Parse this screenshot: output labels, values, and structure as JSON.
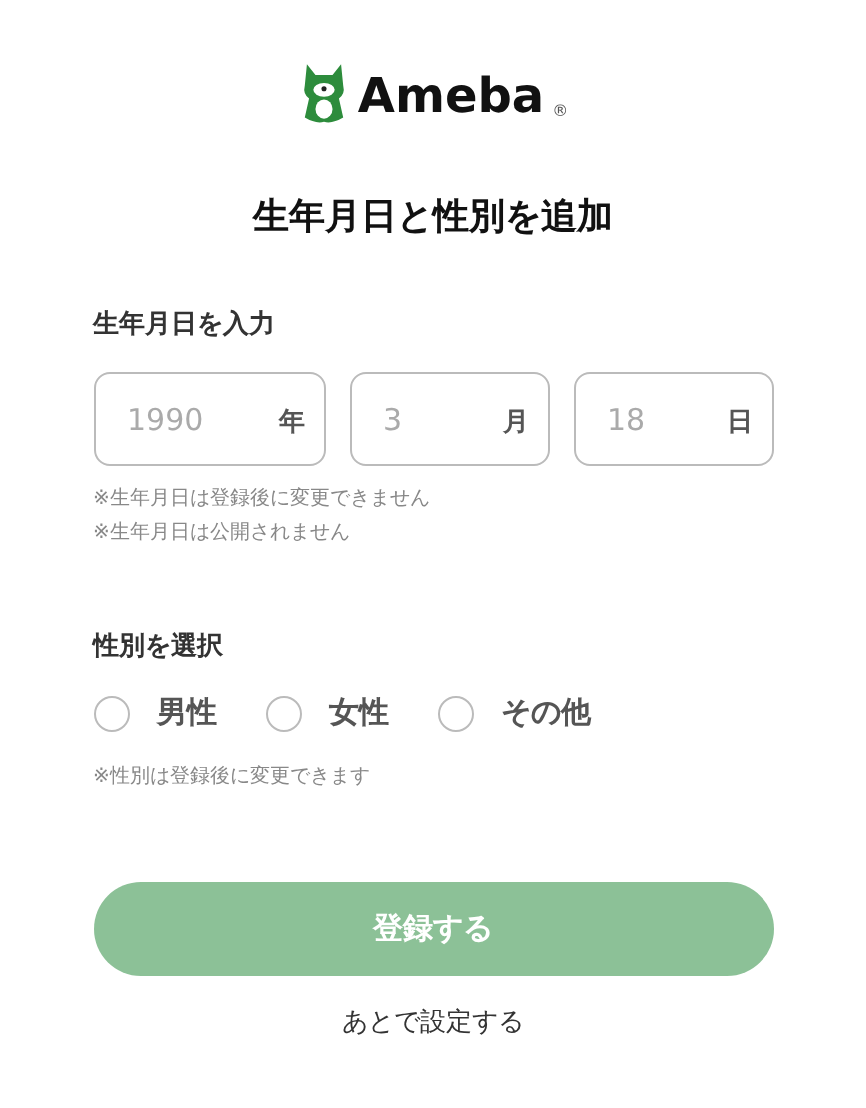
{
  "logo": {
    "text": "Ameba",
    "mark": "®"
  },
  "title": "生年月日と性別を追加",
  "birthday": {
    "label": "生年月日を入力",
    "fields": [
      {
        "placeholder": "1990",
        "unit": "年"
      },
      {
        "placeholder": "3",
        "unit": "月"
      },
      {
        "placeholder": "18",
        "unit": "日"
      }
    ],
    "notes": [
      "※生年月日は登録後に変更できません",
      "※生年月日は公開されません"
    ]
  },
  "gender": {
    "label": "性別を選択",
    "options": [
      {
        "label": "男性",
        "selected": false
      },
      {
        "label": "女性",
        "selected": false
      },
      {
        "label": "その他",
        "selected": false
      }
    ],
    "note": "※性別は登録後に変更できます"
  },
  "submit": {
    "label": "登録する",
    "disabled": true
  },
  "later_link": "あとで設定する"
}
